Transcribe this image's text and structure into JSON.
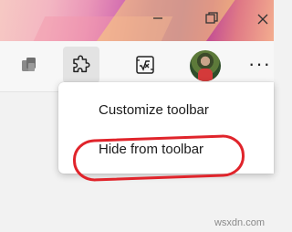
{
  "menu": {
    "items": [
      {
        "label": "Customize toolbar"
      },
      {
        "label": "Hide from toolbar"
      }
    ]
  },
  "toolbar": {
    "more_label": "···"
  },
  "watermark": "wsxdn.com",
  "colors": {
    "highlight": "#e0242b"
  }
}
